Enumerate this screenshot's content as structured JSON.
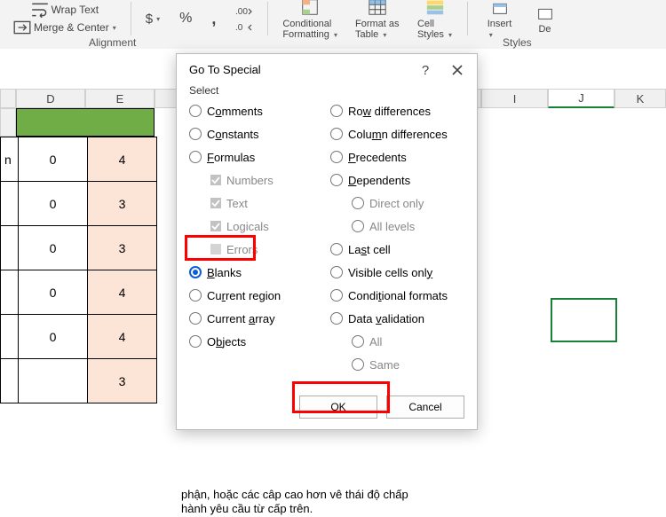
{
  "ribbon": {
    "wrap_label": "Wrap Text",
    "merge_label": "Merge & Center",
    "alignment_cap": "Alignment",
    "currency_sym": "$",
    "pct_sym": "%",
    "comma_sym": ",",
    "dec_inc": ".00",
    "cond_label1": "Conditional",
    "cond_label2": "Formatting",
    "fmt_label1": "Format as",
    "fmt_label2": "Table",
    "cell_label1": "Cell",
    "cell_label2": "Styles",
    "styles_cap": "Styles",
    "insert_label": "Insert",
    "delete_label": "De"
  },
  "sheet": {
    "colD": "D",
    "colE": "E",
    "colI": "I",
    "colJ": "J",
    "colK": "K",
    "rows": [
      [
        "n",
        "0",
        "4"
      ],
      [
        "",
        "0",
        "3"
      ],
      [
        "",
        "0",
        "3"
      ],
      [
        "",
        "0",
        "4"
      ],
      [
        "",
        "0",
        "4"
      ],
      [
        "",
        "",
        "3"
      ]
    ]
  },
  "bottom_text": "phận, hoặc các câp cao hơn vê thái độ chấp hành yêu cầu từ cấp trên.",
  "dialog": {
    "title": "Go To Special",
    "select_label": "Select",
    "left": [
      {
        "t": "radio",
        "label_pre": "C",
        "label_u": "o",
        "label_post": "mments"
      },
      {
        "t": "radio",
        "label_pre": "C",
        "label_u": "o",
        "label_post": "nstants"
      },
      {
        "t": "radio",
        "label_pre": "",
        "label_u": "F",
        "label_post": "ormulas"
      },
      {
        "t": "chk",
        "sub": true,
        "label": "Numbers"
      },
      {
        "t": "chk",
        "sub": true,
        "label": "Text"
      },
      {
        "t": "chk",
        "sub": true,
        "label": "Logicals"
      },
      {
        "t": "chk",
        "sub": true,
        "label": "Errors",
        "off": true
      },
      {
        "t": "radio",
        "sel": true,
        "label_pre": "",
        "label_u": "B",
        "label_post": "lanks"
      },
      {
        "t": "radio",
        "label_pre": "Cu",
        "label_u": "r",
        "label_post": "rent region"
      },
      {
        "t": "radio",
        "label_pre": "Current ",
        "label_u": "a",
        "label_post": "rray"
      },
      {
        "t": "radio",
        "label_pre": "O",
        "label_u": "b",
        "label_post": "jects"
      }
    ],
    "right": [
      {
        "t": "radio",
        "label_pre": "Ro",
        "label_u": "w",
        "label_post": " differences"
      },
      {
        "t": "radio",
        "label_pre": "Colu",
        "label_u": "m",
        "label_post": "n differences"
      },
      {
        "t": "radio",
        "label_pre": "",
        "label_u": "P",
        "label_post": "recedents"
      },
      {
        "t": "radio",
        "label_pre": "",
        "label_u": "D",
        "label_post": "ependents"
      },
      {
        "t": "radio",
        "sub": true,
        "label": "Direct only"
      },
      {
        "t": "radio",
        "sub": true,
        "label": "All levels"
      },
      {
        "t": "radio",
        "label_pre": "La",
        "label_u": "s",
        "label_post": "t cell"
      },
      {
        "t": "radio",
        "label_pre": "Visible cells onl",
        "label_u": "y",
        "label_post": ""
      },
      {
        "t": "radio",
        "label_pre": "Condi",
        "label_u": "t",
        "label_post": "ional formats"
      },
      {
        "t": "radio",
        "label_pre": "Data ",
        "label_u": "v",
        "label_post": "alidation"
      },
      {
        "t": "radio",
        "sub": true,
        "label": "All"
      },
      {
        "t": "radio",
        "sub": true,
        "label": "Same"
      }
    ],
    "ok_label": "OK",
    "cancel_label": "Cancel"
  }
}
